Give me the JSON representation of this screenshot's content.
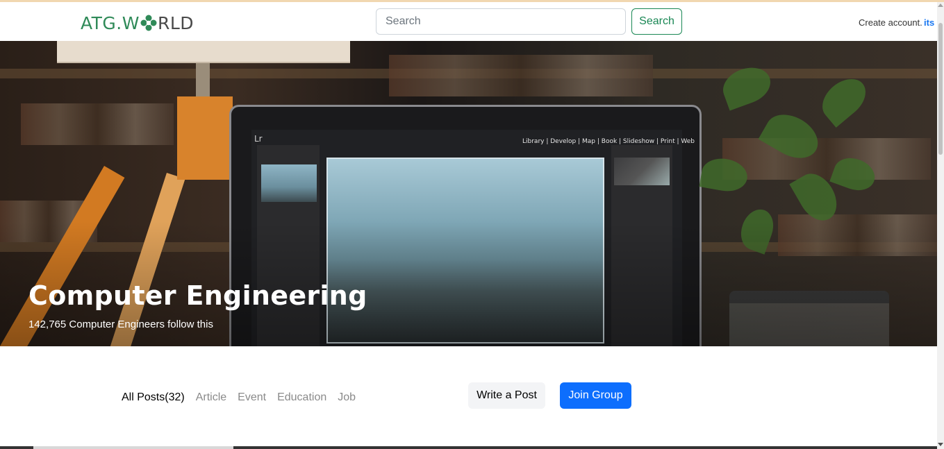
{
  "header": {
    "logo_part_a": "ATG.W",
    "logo_part_b": "RLD",
    "logo_icon": "atg-world-logo-icon",
    "search": {
      "placeholder": "Search"
    },
    "search_button_label": "Search",
    "create_account_text": "Create account.",
    "create_account_link": "its"
  },
  "hero": {
    "title": "Computer Engineering",
    "followers_text": "142,765 Computer Engineers follow this",
    "image_screen_logo": "Lr",
    "image_screen_menu": "Library | Develop | Map | Book | Slideshow | Print | Web"
  },
  "tabs": [
    {
      "label": "All Posts(32)"
    },
    {
      "label": "Article"
    },
    {
      "label": "Event"
    },
    {
      "label": "Education"
    },
    {
      "label": "Job"
    }
  ],
  "actions": {
    "write_post_label": "Write a Post",
    "join_group_label": "Join Group"
  },
  "colors": {
    "brand_green": "#2f8a58",
    "search_button": "#198754",
    "join_button": "#0d6efd",
    "link_blue": "#1877f2"
  }
}
